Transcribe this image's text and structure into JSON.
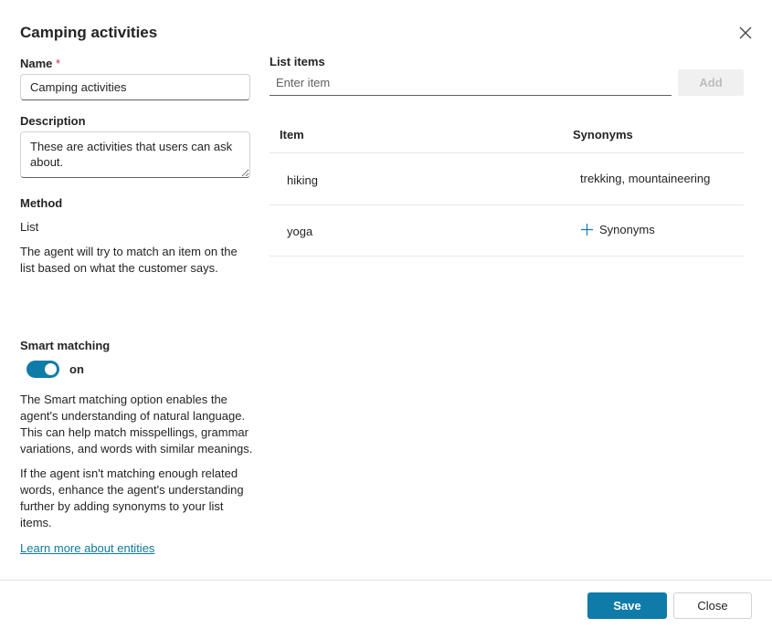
{
  "dialog": {
    "title": "Camping activities",
    "close_icon": "close-icon"
  },
  "left": {
    "name_label": "Name",
    "required_mark": "*",
    "name_value": "Camping activities",
    "description_label": "Description",
    "description_value": "These are activities that users can ask about.",
    "method_label": "Method",
    "method_value": "List",
    "method_help": "The agent will try to match an item on the list based on what the customer says.",
    "smart_matching_label": "Smart matching",
    "smart_matching_state": "on",
    "smart_matching_enabled": true,
    "smart_help_1": "The Smart matching option enables the agent's understanding of natural language. This can help match misspellings, grammar variations, and words with similar meanings.",
    "smart_help_2": "If the agent isn't matching enough related words, enhance the agent's understanding further by adding synonyms to your list items.",
    "learn_more_link": "Learn more about entities"
  },
  "right": {
    "list_items_label": "List items",
    "item_input_placeholder": "Enter item",
    "item_input_value": "",
    "add_button": "Add",
    "columns": [
      "Item",
      "Synonyms"
    ],
    "rows": [
      {
        "item": "hiking",
        "synonyms": "trekking, mountaineering"
      },
      {
        "item": "yoga",
        "synonyms": "",
        "add_synonyms_label": "Synonyms"
      }
    ]
  },
  "footer": {
    "save_button": "Save",
    "close_button": "Close"
  },
  "colors": {
    "accent": "#0f7ba8",
    "required": "#c4314b"
  }
}
